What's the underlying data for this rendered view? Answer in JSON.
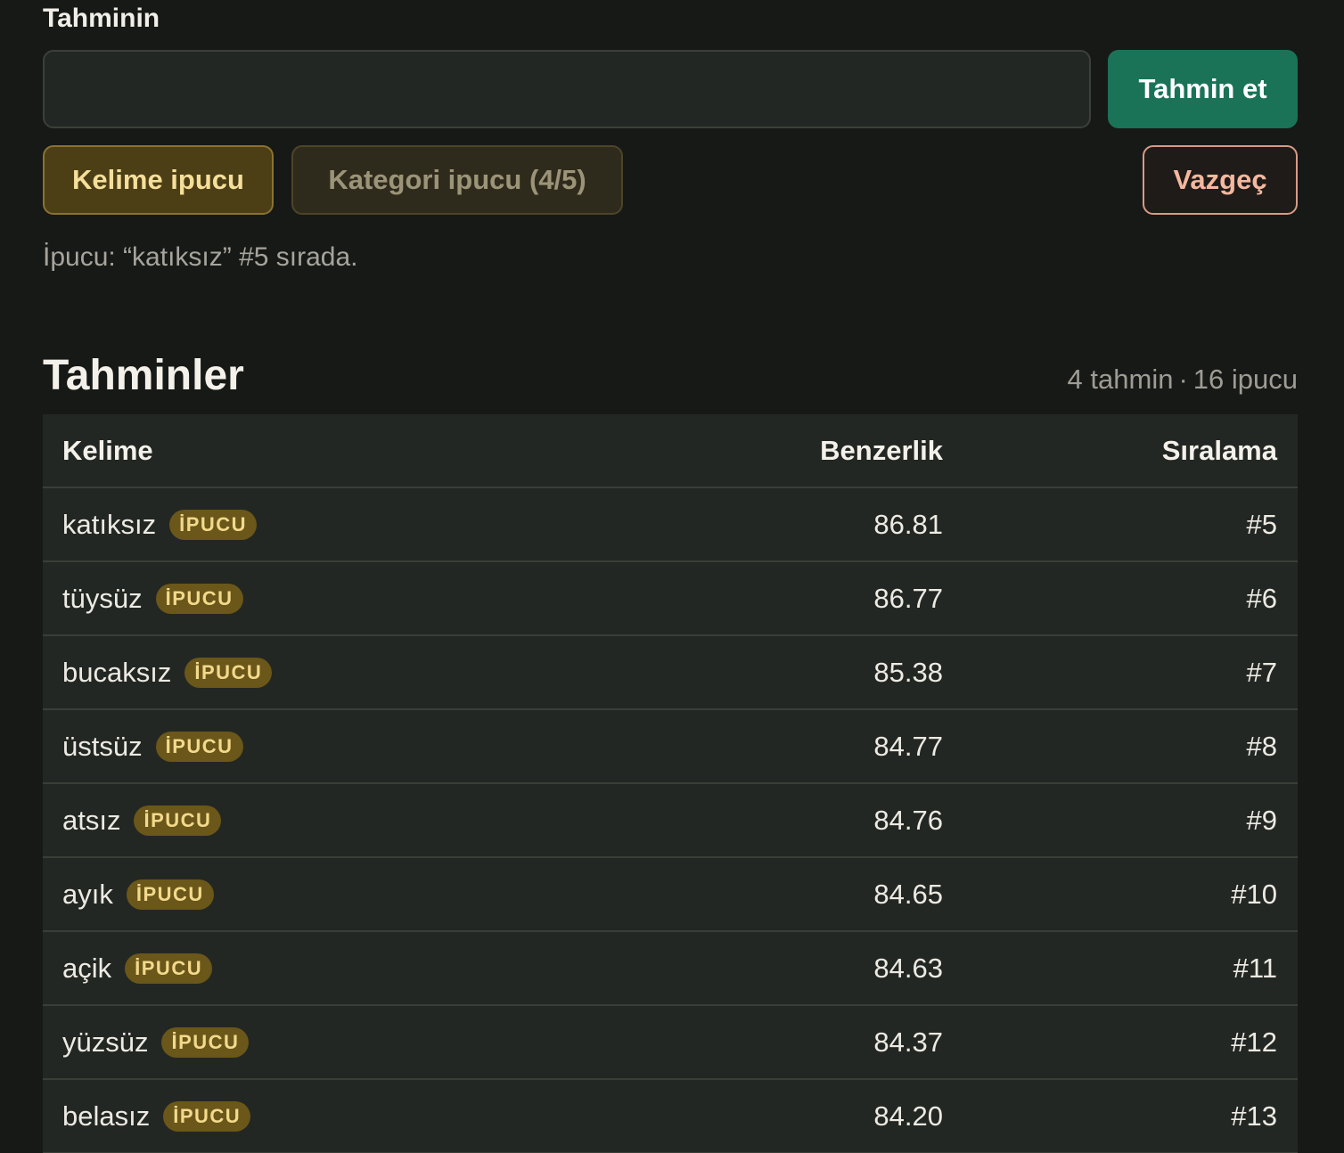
{
  "form": {
    "label": "Tahminin",
    "input_value": "",
    "input_placeholder": "",
    "submit_label": "Tahmin et",
    "word_hint_label": "Kelime ipucu",
    "category_hint_label": "Kategori ipucu (4/5)",
    "give_up_label": "Vazgeç",
    "hint_message": "İpucu: “katıksız” #5 sırada."
  },
  "guesses": {
    "title": "Tahminler",
    "guess_count": "4 tahmin",
    "separator": "·",
    "hint_count": "16 ipucu",
    "columns": {
      "word": "Kelime",
      "similarity": "Benzerlik",
      "rank": "Sıralama"
    },
    "badge_label": "İPUCU",
    "rows": [
      {
        "word": "katıksız",
        "similarity": "86.81",
        "rank": "#5"
      },
      {
        "word": "tüysüz",
        "similarity": "86.77",
        "rank": "#6"
      },
      {
        "word": "bucaksız",
        "similarity": "85.38",
        "rank": "#7"
      },
      {
        "word": "üstsüz",
        "similarity": "84.77",
        "rank": "#8"
      },
      {
        "word": "atsız",
        "similarity": "84.76",
        "rank": "#9"
      },
      {
        "word": "ayık",
        "similarity": "84.65",
        "rank": "#10"
      },
      {
        "word": "açik",
        "similarity": "84.63",
        "rank": "#11"
      },
      {
        "word": "yüzsüz",
        "similarity": "84.37",
        "rank": "#12"
      },
      {
        "word": "belasız",
        "similarity": "84.20",
        "rank": "#13"
      }
    ]
  },
  "colors": {
    "background": "#171917",
    "primary_button": "#1a7357",
    "hint_badge": "#6a5719",
    "give_up_border": "#d89b86"
  }
}
